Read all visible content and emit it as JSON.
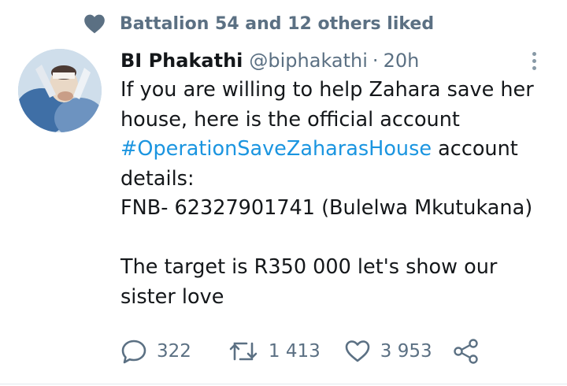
{
  "social_context": {
    "text": "Battalion 54 and 12 others liked",
    "icon": "heart-icon"
  },
  "tweet": {
    "author_name": "BI Phakathi",
    "handle": "@biphakathi",
    "separator": "·",
    "time": "20h",
    "body": {
      "line1": "If you are willing to help Zahara save her",
      "line2": "house, here is the official account",
      "hashtag": "#OperationSaveZaharasHouse",
      "line3_rest": " account",
      "line4": "details:",
      "line5": "FNB- 62327901741 (Bulelwa Mkutukana)",
      "line6": "The target is R350 000 let's show our",
      "line7": "sister love"
    },
    "actions": {
      "replies": "322",
      "retweets": "1 413",
      "likes": "3 953"
    }
  },
  "colors": {
    "primary_text": "#14171a",
    "secondary_text": "#5b7083",
    "hashtag": "#1b95e0",
    "icon_gray": "#5b7083"
  }
}
